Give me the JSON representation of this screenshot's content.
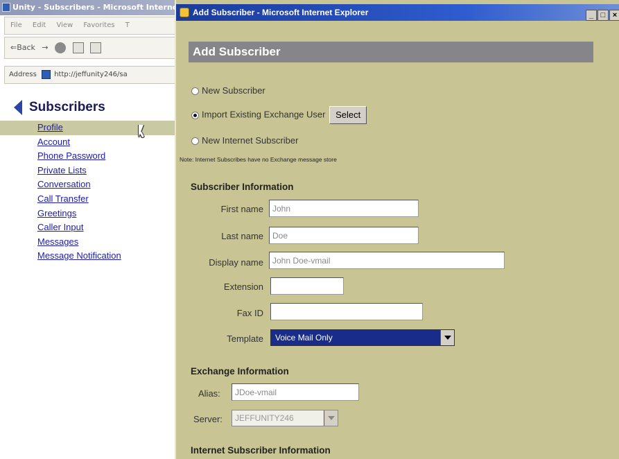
{
  "background_window": {
    "title": "Unity - Subscribers - Microsoft Internet Explorer",
    "menu": [
      "File",
      "Edit",
      "View",
      "Favorites",
      "T"
    ],
    "toolbar": {
      "back_label": "⇐Back",
      "forward_label": "→"
    },
    "address_label": "Address",
    "address_url": "http://jeffunity246/sa",
    "nav_heading": "Subscribers",
    "nav_items": [
      "Profile",
      "Account",
      "Phone Password",
      "Private Lists",
      "Conversation",
      "Call Transfer",
      "Greetings",
      "Caller Input",
      "Messages",
      "Message Notification"
    ],
    "active_item": "Profile"
  },
  "dialog": {
    "title": "Add Subscriber - Microsoft Internet Explorer",
    "controls": [
      "_",
      "□",
      "×"
    ],
    "header": "Add Subscriber",
    "radio_options": [
      {
        "label": "New Subscriber",
        "checked": false
      },
      {
        "label": "Import Existing Exchange User",
        "checked": true
      },
      {
        "label": "New Internet Subscriber",
        "checked": false
      }
    ],
    "select_button": "Select",
    "note": "Note: Internet Subscribes have no Exchange message store",
    "subscriber_info": {
      "title": "Subscriber Information",
      "first_name_label": "First name",
      "first_name_value": "John",
      "last_name_label": "Last name",
      "last_name_value": "Doe",
      "display_name_label": "Display name",
      "display_name_value": "John Doe-vmail",
      "extension_label": "Extension",
      "extension_value": "",
      "fax_id_label": "Fax ID",
      "fax_id_value": "",
      "template_label": "Template",
      "template_value": "Voice Mail Only"
    },
    "exchange_info": {
      "title": "Exchange Information",
      "alias_label": "Alias:",
      "alias_value": "JDoe-vmail",
      "server_label": "Server:",
      "server_value": "JEFFUNITY246"
    },
    "internet_info": {
      "title": "Internet Subscriber Information"
    }
  },
  "colors": {
    "dialog_bg": "#c9c493",
    "header_bar": "#86868a",
    "nav_link": "#1b1bb5",
    "template_highlight": "#1a2c8a"
  }
}
